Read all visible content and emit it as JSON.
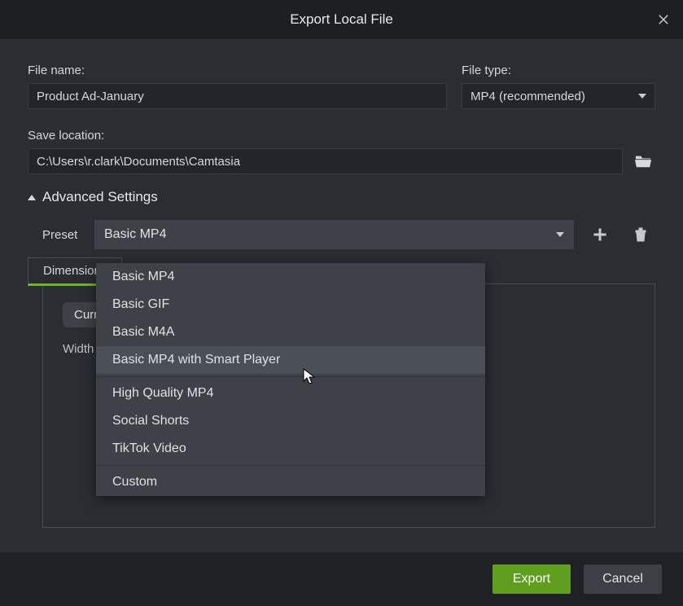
{
  "dialog": {
    "title": "Export Local File"
  },
  "fields": {
    "filename_label": "File name:",
    "filename_value": "Product Ad-January",
    "filetype_label": "File type:",
    "filetype_value": "MP4 (recommended)",
    "savelocation_label": "Save location:",
    "savelocation_value": "C:\\Users\\r.clark\\Documents\\Camtasia"
  },
  "advanced": {
    "toggle_label": "Advanced Settings",
    "preset_label": "Preset",
    "preset_value": "Basic MP4",
    "tab_dimensions": "Dimensions",
    "current_btn": "Current",
    "width_label": "Width"
  },
  "preset_options": {
    "group1": [
      "Basic MP4",
      "Basic GIF",
      "Basic M4A",
      "Basic MP4 with Smart Player"
    ],
    "group2": [
      "High Quality MP4",
      "Social Shorts",
      "TikTok Video"
    ],
    "group3": [
      "Custom"
    ],
    "hovered": "Basic MP4 with Smart Player"
  },
  "footer": {
    "export": "Export",
    "cancel": "Cancel"
  }
}
